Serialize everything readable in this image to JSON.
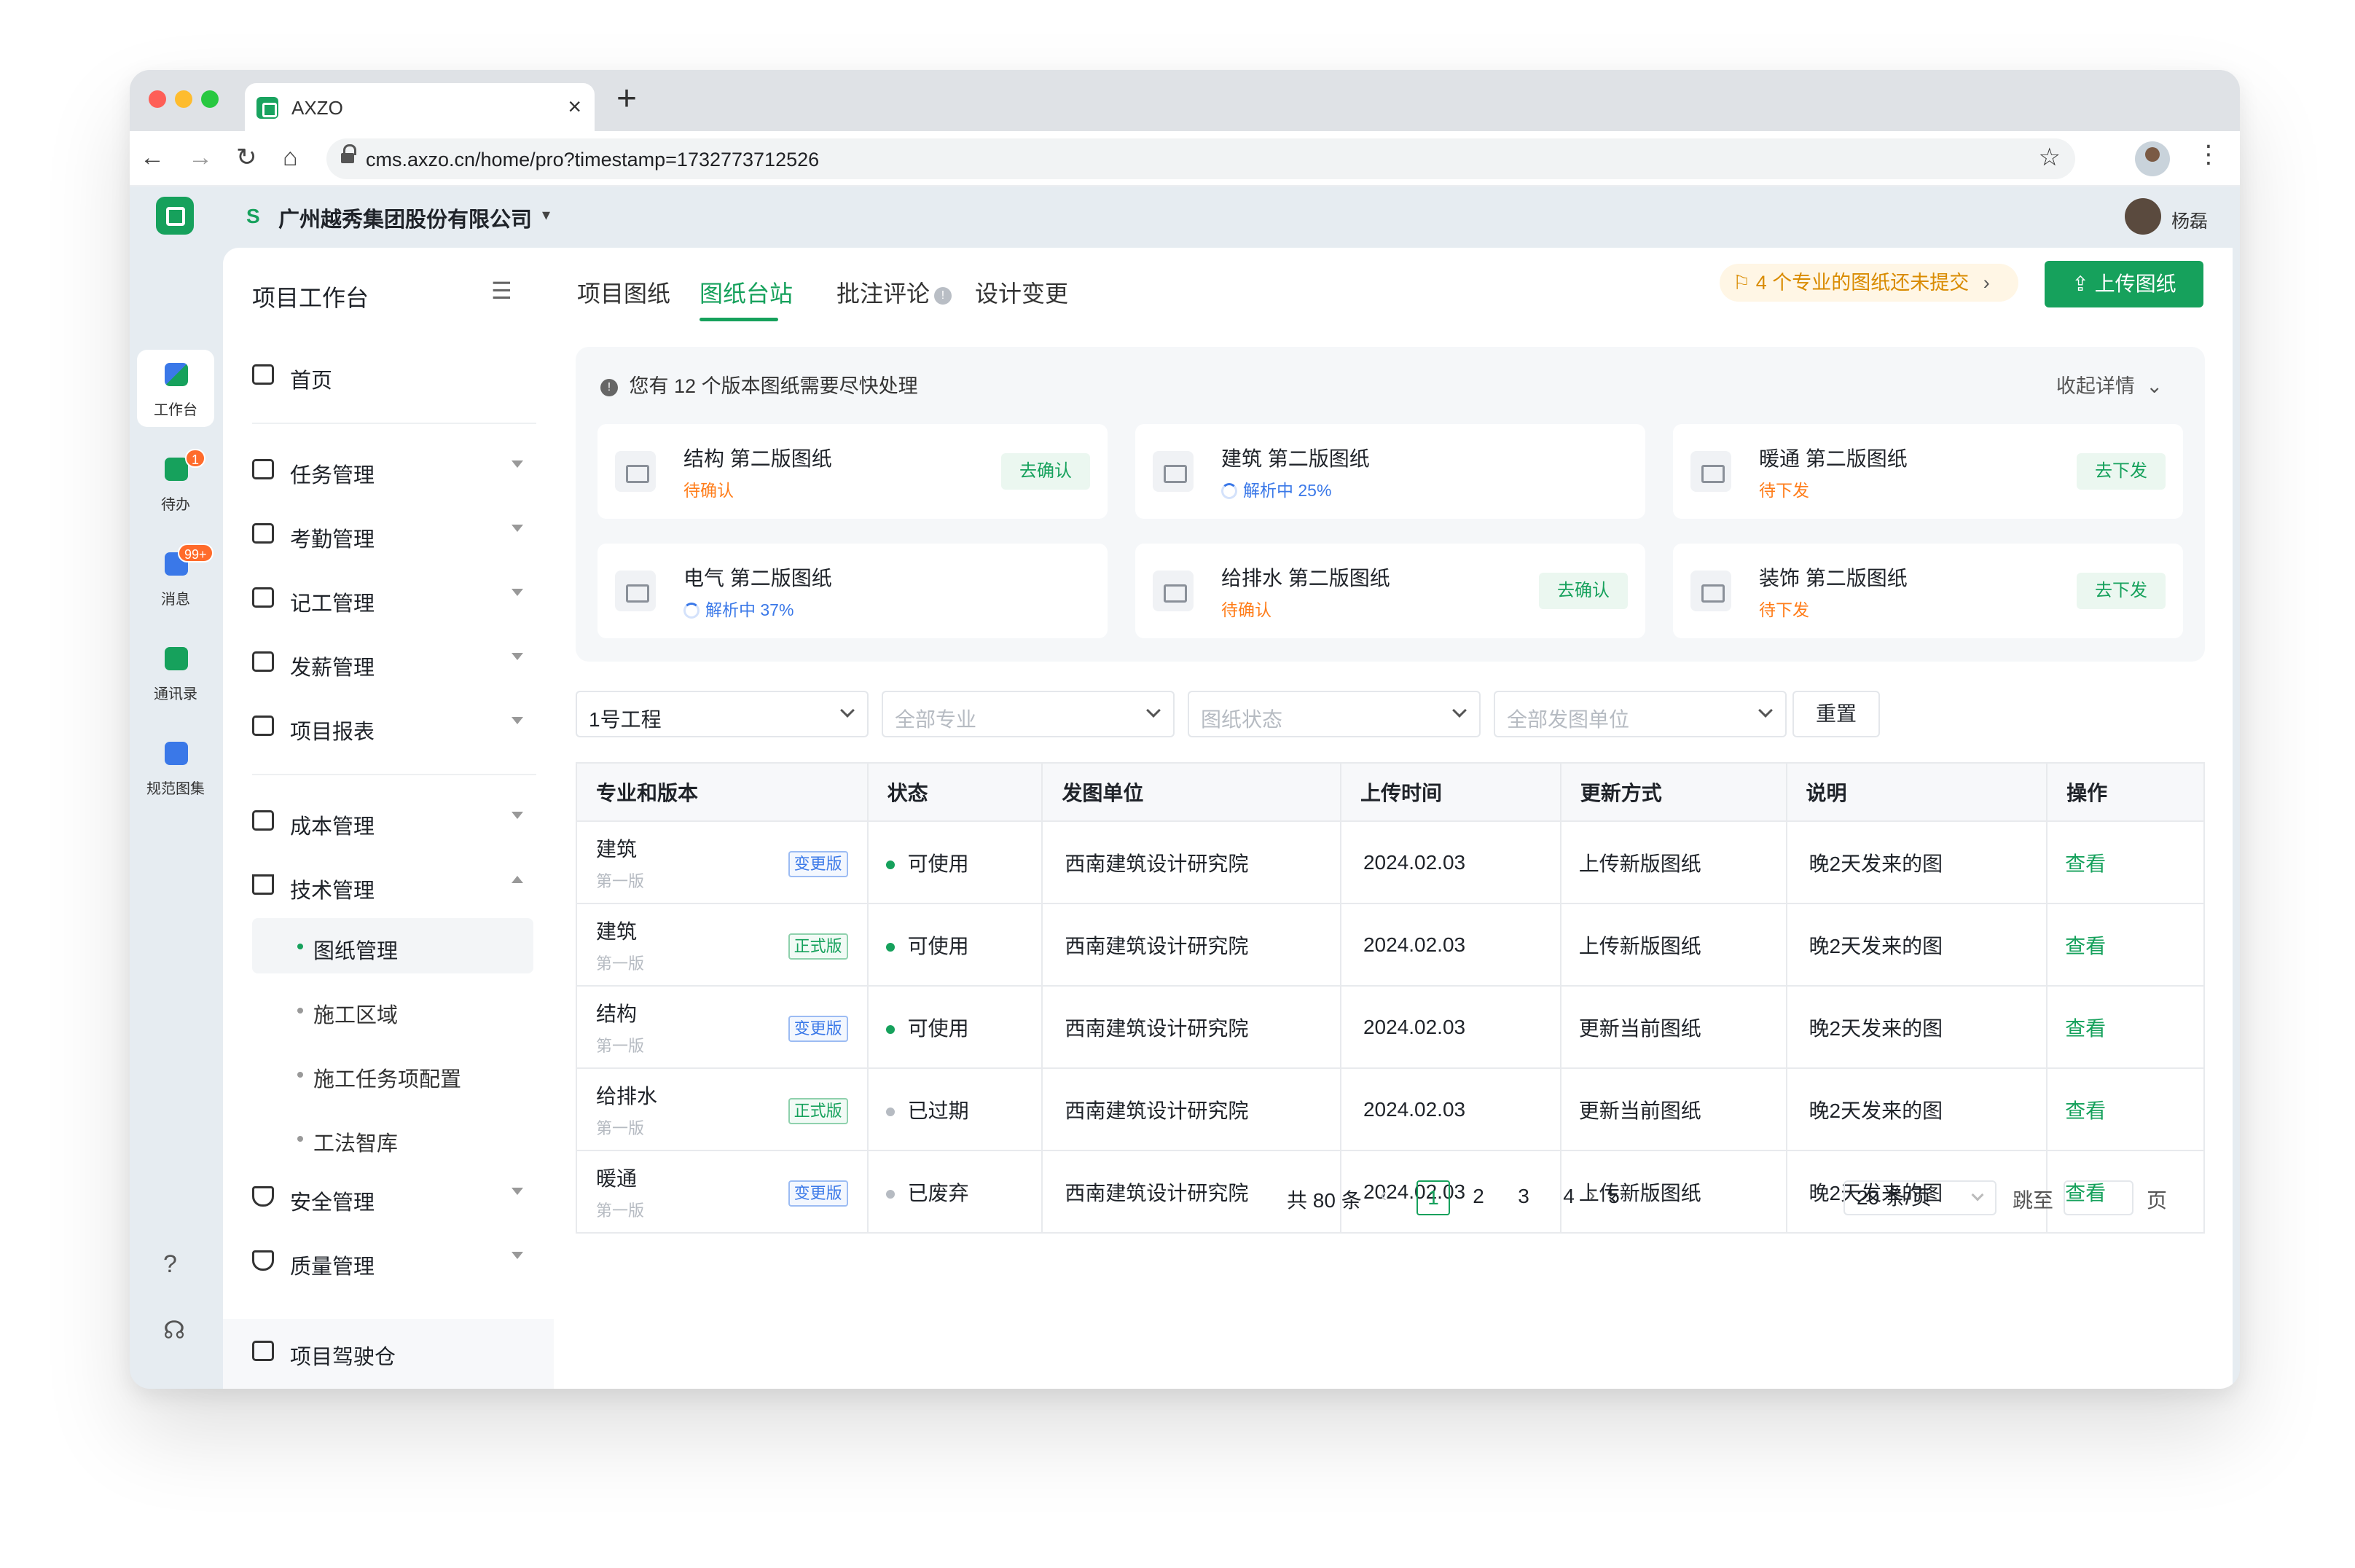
{
  "browser": {
    "tab_title": "AXZO",
    "tab_close": "×",
    "new_tab": "+",
    "url": "cms.axzo.cn/home/pro?timestamp=1732773712526",
    "nav": {
      "back": "←",
      "forward": "→",
      "reload": "↻",
      "home": "⌂",
      "star": "☆",
      "menu": "⋮"
    }
  },
  "header": {
    "company": "广州越秀集团股份有限公司",
    "company_caret": "▾",
    "user_name": "杨磊"
  },
  "rail": {
    "items": [
      {
        "label": "工作台",
        "active": true
      },
      {
        "label": "待办",
        "badge": "1"
      },
      {
        "label": "消息",
        "badge": "99+"
      },
      {
        "label": "通讯录"
      },
      {
        "label": "规范图集"
      }
    ],
    "help_icon": "?",
    "service_icon": "☊"
  },
  "sidebar": {
    "title": "项目工作台",
    "collapse_icon": "☰",
    "items": [
      {
        "label": "首页"
      },
      {
        "label": "任务管理"
      },
      {
        "label": "考勤管理"
      },
      {
        "label": "记工管理"
      },
      {
        "label": "发薪管理"
      },
      {
        "label": "项目报表"
      },
      {
        "label": "成本管理"
      },
      {
        "label": "技术管理"
      },
      {
        "label": "安全管理"
      },
      {
        "label": "质量管理"
      }
    ],
    "sub_items": [
      {
        "label": "图纸管理",
        "active": true
      },
      {
        "label": "施工区域"
      },
      {
        "label": "施工任务项配置"
      },
      {
        "label": "工法智库"
      }
    ],
    "footer": {
      "label": "项目驾驶仓"
    }
  },
  "main": {
    "tabs": [
      {
        "label": "项目图纸"
      },
      {
        "label": "图纸台站",
        "active": true
      },
      {
        "label": "批注评论",
        "info": "!"
      },
      {
        "label": "设计变更"
      }
    ],
    "notice": "4 个专业的图纸还未提交",
    "notice_icon": "⚐",
    "notice_chevron": "›",
    "upload_button": "上传图纸",
    "upload_icon": "⇪",
    "panel": {
      "info_icon": "!",
      "head_prefix": "您有",
      "head_count": "12",
      "head_suffix": "个版本图纸需要尽快处理",
      "toggle": "收起详情",
      "toggle_icon": "⌄",
      "cards": [
        {
          "title": "结构 第二版图纸",
          "status": "待确认",
          "status_type": "orange",
          "action": "去确认"
        },
        {
          "title": "建筑 第二版图纸",
          "status": "解析中 25%",
          "status_type": "blue",
          "action": ""
        },
        {
          "title": "暖通 第二版图纸",
          "status": "待下发",
          "status_type": "orange",
          "action": "去下发"
        },
        {
          "title": "电气 第二版图纸",
          "status": "解析中 37%",
          "status_type": "blue",
          "action": ""
        },
        {
          "title": "给排水 第二版图纸",
          "status": "待确认",
          "status_type": "orange",
          "action": "去确认"
        },
        {
          "title": "装饰 第二版图纸",
          "status": "待下发",
          "status_type": "orange",
          "action": "去下发"
        }
      ]
    },
    "filters": [
      {
        "value": "1号工程",
        "placeholder": false
      },
      {
        "value": "全部专业",
        "placeholder": true
      },
      {
        "value": "图纸状态",
        "placeholder": true
      },
      {
        "value": "全部发图单位",
        "placeholder": true
      }
    ],
    "reset_button": "重置",
    "table": {
      "columns": [
        "专业和版本",
        "状态",
        "发图单位",
        "上传时间",
        "更新方式",
        "说明",
        "操作"
      ],
      "rows": [
        {
          "name": "建筑",
          "version": "第一版",
          "tag": "变更版",
          "tag_type": "change",
          "status": "可使用",
          "status_type": "g",
          "unit": "西南建筑设计研究院",
          "time": "2024.02.03",
          "method": "上传新版图纸",
          "note": "晚2天发来的图",
          "action": "查看"
        },
        {
          "name": "建筑",
          "version": "第一版",
          "tag": "正式版",
          "tag_type": "formal",
          "status": "可使用",
          "status_type": "g",
          "unit": "西南建筑设计研究院",
          "time": "2024.02.03",
          "method": "上传新版图纸",
          "note": "晚2天发来的图",
          "action": "查看"
        },
        {
          "name": "结构",
          "version": "第一版",
          "tag": "变更版",
          "tag_type": "change",
          "status": "可使用",
          "status_type": "g",
          "unit": "西南建筑设计研究院",
          "time": "2024.02.03",
          "method": "更新当前图纸",
          "note": "晚2天发来的图",
          "action": "查看"
        },
        {
          "name": "给排水",
          "version": "第一版",
          "tag": "正式版",
          "tag_type": "formal",
          "status": "已过期",
          "status_type": "gr",
          "unit": "西南建筑设计研究院",
          "time": "2024.02.03",
          "method": "更新当前图纸",
          "note": "晚2天发来的图",
          "action": "查看"
        },
        {
          "name": "暖通",
          "version": "第一版",
          "tag": "变更版",
          "tag_type": "change",
          "status": "已废弃",
          "status_type": "gr",
          "unit": "西南建筑设计研究院",
          "time": "2024.02.03",
          "method": "上传新版图纸",
          "note": "晚2天发来的图",
          "action": "查看"
        }
      ]
    },
    "pagination": {
      "total": "共 80 条",
      "prev": "‹",
      "next": "›",
      "pages": [
        "1",
        "2",
        "3",
        "4",
        "5"
      ],
      "current": "1",
      "page_size": "20 条/页",
      "jump_label": "跳至",
      "page_unit": "页"
    }
  },
  "colors": {
    "accent": "#16a15c",
    "warning": "#ff7d1a",
    "info": "#3a78e8",
    "badge": "#ff6b2b"
  }
}
